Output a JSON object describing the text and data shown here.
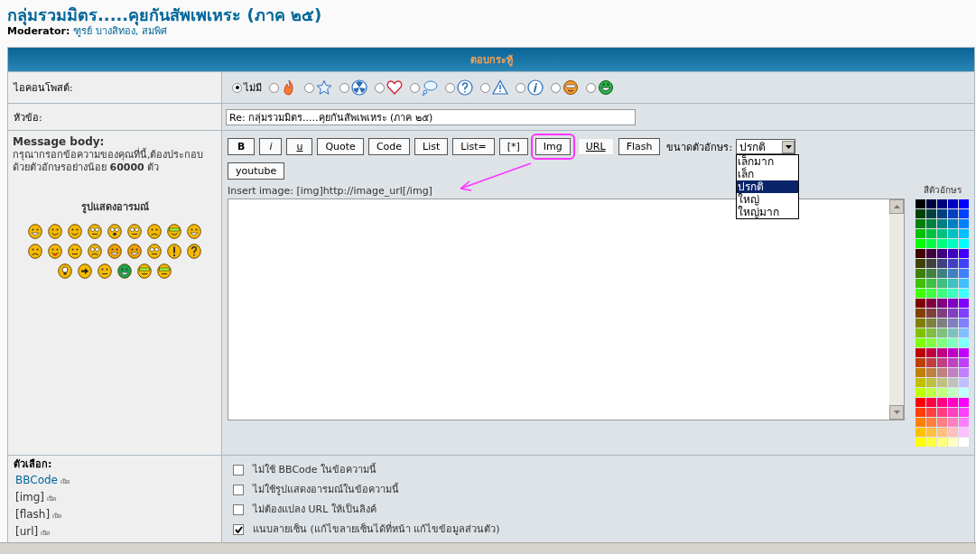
{
  "page": {
    "title": "กลุ่มรวมมิตร.....คุยกันสัพเพเหระ (ภาค ๒๕)",
    "moderator_label": "Moderator:",
    "moderators": "ฑูรย์ บางสิทอง, สมพิศ"
  },
  "form": {
    "header": "ตอบกระทู้",
    "post_icon": {
      "label": "ไอคอนโพสต์:",
      "options": [
        {
          "kind": "none",
          "label": "ไม่มี",
          "selected": true
        },
        {
          "kind": "icon",
          "selected": false
        },
        {
          "kind": "icon",
          "selected": false
        },
        {
          "kind": "icon",
          "selected": false
        },
        {
          "kind": "icon",
          "selected": false
        },
        {
          "kind": "icon",
          "selected": false
        },
        {
          "kind": "icon",
          "selected": false
        },
        {
          "kind": "icon",
          "selected": false
        },
        {
          "kind": "icon",
          "selected": false
        },
        {
          "kind": "icon",
          "selected": false
        },
        {
          "kind": "icon",
          "selected": false
        }
      ]
    },
    "subject": {
      "label": "หัวข้อ:",
      "value": "Re: กลุ่มรวมมิตร.....คุยกันสัพเพเหระ (ภาค ๒๕)"
    },
    "message": {
      "label": "Message body:",
      "hint": "กรุณากรอกข้อความของคุณที่นี้,ต้องประกอบด้วยตัวอักษรอย่างน้อย **60000** ตัว",
      "smilies_title": "รูปแสดงอารมณ์",
      "buttons": [
        {
          "label": "B",
          "kind": "bold",
          "annotated": false
        },
        {
          "label": "i",
          "kind": "italic",
          "annotated": false
        },
        {
          "label": "u",
          "kind": "underline",
          "annotated": false
        },
        {
          "label": "Quote",
          "kind": "plain",
          "annotated": false
        },
        {
          "label": "Code",
          "kind": "plain",
          "annotated": false
        },
        {
          "label": "List",
          "kind": "plain",
          "annotated": false
        },
        {
          "label": "List=",
          "kind": "plain",
          "annotated": false
        },
        {
          "label": "[*]",
          "kind": "plain",
          "annotated": false
        },
        {
          "label": "Img",
          "kind": "plain",
          "annotated": true
        },
        {
          "label": "URL",
          "kind": "link",
          "annotated": false
        },
        {
          "label": "Flash",
          "kind": "plain",
          "annotated": false
        },
        {
          "label": "youtube",
          "kind": "plain",
          "annotated": false
        }
      ],
      "font_size": {
        "label": "ขนาดตัวอักษร:",
        "value": "ปรกติ",
        "expanded": true,
        "options": [
          {
            "label": "เล็กมาก",
            "selected": false
          },
          {
            "label": "เล็ก",
            "selected": false
          },
          {
            "label": "ปรกติ",
            "selected": true
          },
          {
            "label": "ใหญ่",
            "selected": false
          },
          {
            "label": "ใหญ่มาก",
            "selected": false
          }
        ]
      },
      "help_text": "Insert image: [img]http://image_url[/img]",
      "color_label": "สีตัวอักษร"
    },
    "options": {
      "label": "ตัวเลือก:",
      "bbcodes": [
        {
          "code": "BBCode",
          "status": "เปิด",
          "link": true
        },
        {
          "code": "[img]",
          "status": "เปิด",
          "link": false
        },
        {
          "code": "[flash]",
          "status": "เปิด",
          "link": false
        },
        {
          "code": "[url]",
          "status": "เปิด",
          "link": false
        }
      ],
      "checkboxes": [
        {
          "label": "ไม่ใช้ BBCode ในข้อความนี้",
          "checked": false
        },
        {
          "label": "ไม่ใช้รูปแสดงอารมณ์ในข้อความนี้",
          "checked": false
        },
        {
          "label": "ไม่ต้องแปลง URL ให้เป็นลิงค์",
          "checked": false
        },
        {
          "label": "แนบลายเซ็น (แก้ไขลายเซ็นได้ที่หน้า แก้ไขข้อมูลส่วนตัว)",
          "checked": true
        }
      ]
    }
  }
}
